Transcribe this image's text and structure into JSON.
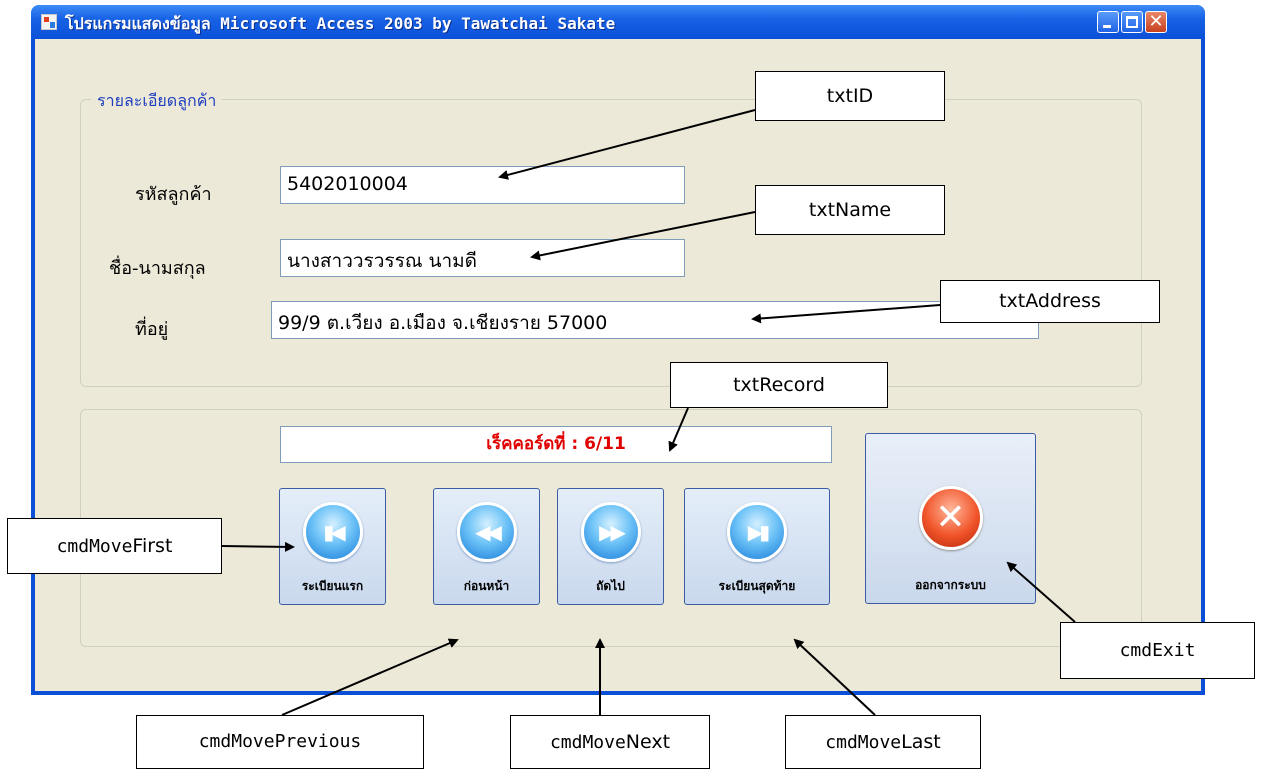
{
  "window": {
    "title": "โปรแกรมแสดงข้อมูล  Microsoft Access 2003  by  Tawatchai  Sakate"
  },
  "customer_group": {
    "title": "รายละเอียดลูกค้า",
    "id_label": "รหัสลูกค้า",
    "id_value": "5402010004",
    "name_label": "ชื่อ-นามสกุล",
    "name_value": "นางสาววรวรรณ  นามดี",
    "address_label": "ที่อยู่",
    "address_value": "99/9 ต.เวียง อ.เมือง จ.เชียงราย 57000"
  },
  "navigation": {
    "record_text": "เร็คคอร์ดที่ : 6/11",
    "first_label": "ระเบียนแรก",
    "previous_label": "ก่อนหน้า",
    "next_label": "ถัดไป",
    "last_label": "ระเบียนสุดท้าย",
    "exit_label": "ออกจากระบบ"
  },
  "callouts": {
    "txtID": "txtID",
    "txtName": "txtName",
    "txtAddress": "txtAddress",
    "txtRecord": "txtRecord",
    "cmdMoveFirst_prefix": "cmdMove",
    "cmdMoveFirst_suffix": "First",
    "cmdMovePrevious": "cmdMovePrevious",
    "cmdMoveNext_prefix": "cmdMove",
    "cmdMoveNext_suffix": "Next",
    "cmdMoveLast_prefix": "cmdMove",
    "cmdMoveLast_suffix": "Last",
    "cmdExit": "cmdExit"
  },
  "icons": {
    "first": "skip-first-icon",
    "previous": "rewind-icon",
    "next": "fast-forward-icon",
    "last": "skip-last-icon",
    "exit": "close-x-icon"
  }
}
